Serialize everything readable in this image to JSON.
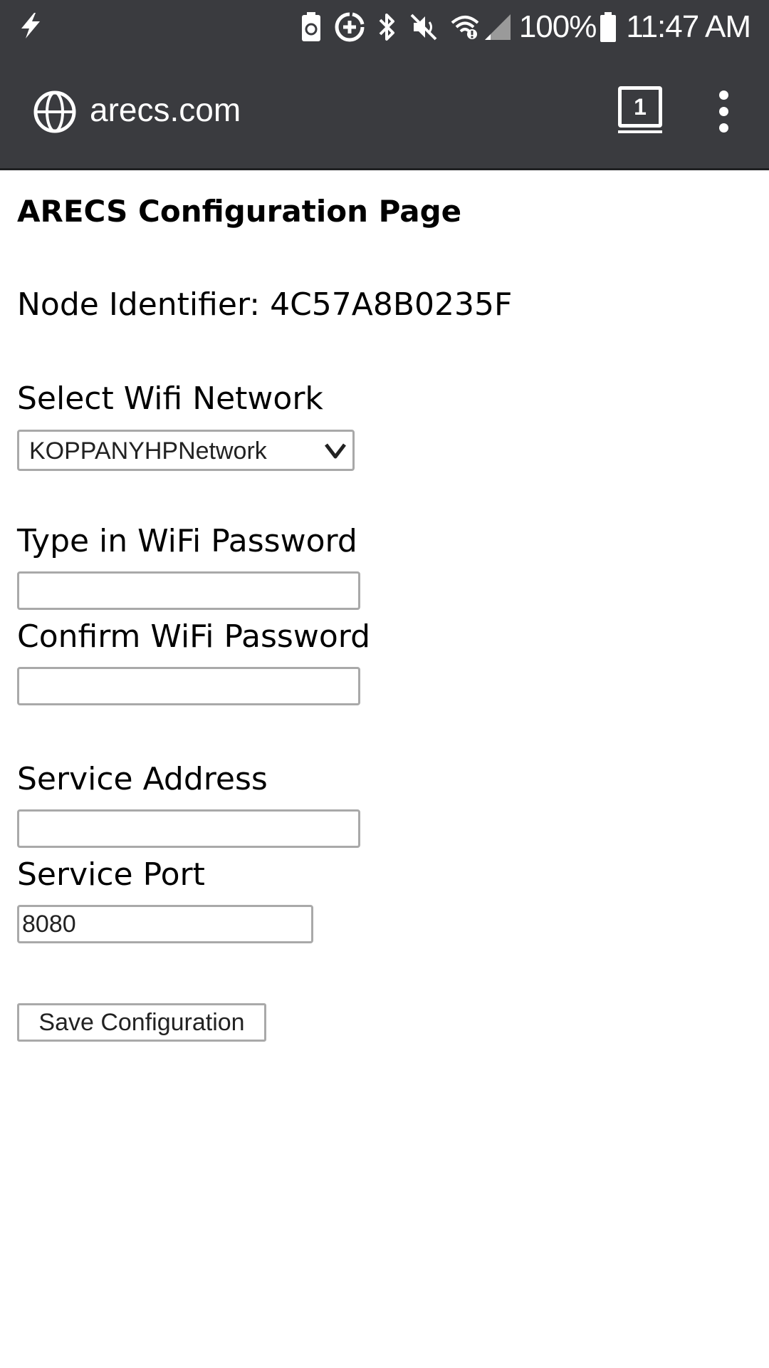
{
  "status_bar": {
    "battery_percent": "100%",
    "time": "11:47 AM",
    "icons": [
      "flash-icon",
      "battery-saver-icon",
      "data-saver-icon",
      "bluetooth-icon",
      "mute-icon",
      "wifi-icon",
      "cell-signal-icon",
      "battery-icon"
    ]
  },
  "browser": {
    "url": "arecs.com",
    "tab_count": "1",
    "icons": [
      "globe-icon",
      "tabs-icon",
      "more-menu-icon"
    ]
  },
  "page": {
    "title": "ARECS Configuration Page",
    "node_identifier": "Node Identifier: 4C57A8B0235F",
    "wifi_network_label": "Select Wifi Network",
    "wifi_network_selected": "KOPPANYHPNetwork",
    "wifi_password_label": "Type in WiFi Password",
    "wifi_password_value": "",
    "confirm_password_label": "Confirm WiFi Password",
    "confirm_password_value": "",
    "service_address_label": "Service Address",
    "service_address_value": "",
    "service_port_label": "Service Port",
    "service_port_value": "8080",
    "save_button": "Save Configuration"
  },
  "colors": {
    "toolbar_bg": "#3a3b3f",
    "input_border": "#a9a9a9"
  }
}
